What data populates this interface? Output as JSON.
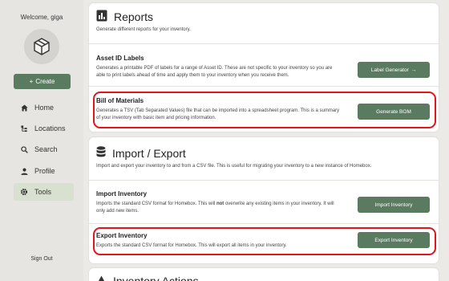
{
  "sidebar": {
    "welcome": "Welcome, giga",
    "create_label": "Create",
    "create_plus": "+",
    "nav": [
      {
        "label": "Home",
        "icon": "home-icon"
      },
      {
        "label": "Locations",
        "icon": "locations-icon"
      },
      {
        "label": "Search",
        "icon": "search-icon"
      },
      {
        "label": "Profile",
        "icon": "profile-icon"
      },
      {
        "label": "Tools",
        "icon": "tools-icon"
      }
    ],
    "signout": "Sign Out"
  },
  "reports": {
    "title": "Reports",
    "description": "Generate different reports for your inventory.",
    "items": [
      {
        "title": "Asset ID Labels",
        "description_line1": "Generates a printable PDF of labels for a range of Asset ID. These are not specific to your inventory so you are",
        "description_line2": "able to print labels ahead of time and apply them to your inventory when you receive them.",
        "button": "Label Generator",
        "button_arrow": "→"
      },
      {
        "title": "Bill of Materials",
        "description_line1": "Generates a TSV (Tab Separated Values) file that can be imported into a spreadsheet program. This is a summary",
        "description_line2": "of your inventory with basic item and pricing information.",
        "button": "Generate BOM"
      }
    ]
  },
  "import_export": {
    "title": "Import / Export",
    "description": "Import and export your inventory to and from a CSV file. This is useful for migrating your inventory to a new instance of Homebox.",
    "items": [
      {
        "title": "Import Inventory",
        "description_pre": "Imports the standard CSV format for Homebox. This will ",
        "description_bold": "not",
        "description_post": " overwrite any existing items in your inventory. It will",
        "description_line2": "only add new items.",
        "button": "Import Inventory"
      },
      {
        "title": "Export Inventory",
        "description": "Exports the standard CSV format for Homebox. This will export all items in your inventory.",
        "button": "Export Inventory"
      }
    ]
  },
  "actions": {
    "title": "Inventory Actions"
  },
  "colors": {
    "accent": "#5b7b60",
    "highlight": "#e2151b",
    "active_nav": "#d8e1cf"
  }
}
